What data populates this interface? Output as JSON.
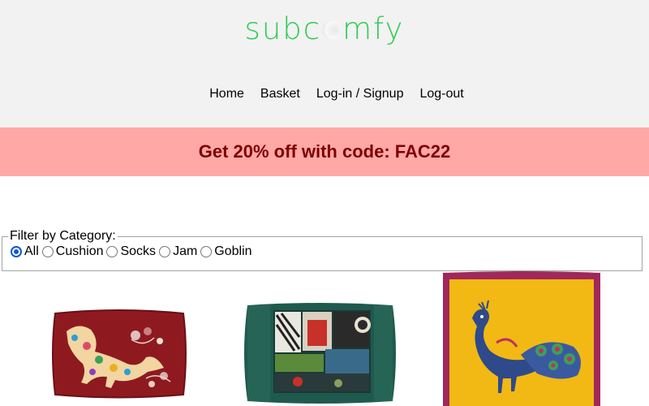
{
  "header": {
    "logo_left": "subc",
    "logo_right": "mfy",
    "nav": [
      "Home",
      "Basket",
      "Log-in / Signup",
      "Log-out"
    ]
  },
  "promo": {
    "text": "Get 20% off with code: FAC22"
  },
  "filter": {
    "legend": "Filter by Category:",
    "options": [
      "All",
      "Cushion",
      "Socks",
      "Jam",
      "Goblin"
    ],
    "selected": "All"
  },
  "products": [
    {
      "icon": "red-tiger-cushion-image"
    },
    {
      "icon": "patchwork-cushion-image"
    },
    {
      "icon": "peacock-cushion-image"
    }
  ],
  "colors": {
    "logo": "#2ecc52",
    "header_bg": "#f2f2f2",
    "promo_bg": "#ffa8a5",
    "promo_text": "#7f0000",
    "radio_accent": "#0b57d0"
  }
}
